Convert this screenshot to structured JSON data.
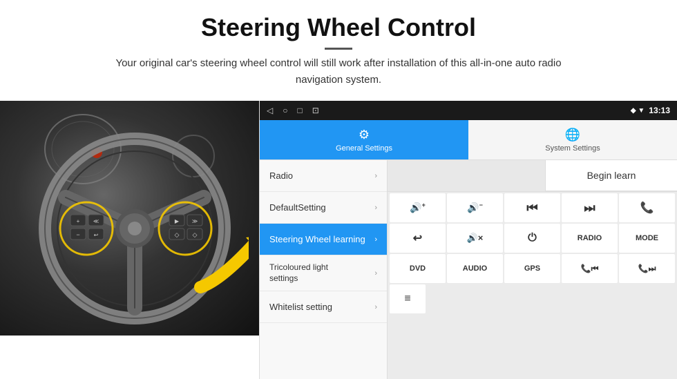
{
  "header": {
    "title": "Steering Wheel Control",
    "subtitle": "Your original car's steering wheel control will still work after installation of this all-in-one auto radio navigation system."
  },
  "status_bar": {
    "nav_back": "◁",
    "nav_home": "○",
    "nav_recent": "□",
    "nav_extra": "⊡",
    "wifi_icon": "wifi",
    "signal_icon": "signal",
    "time": "13:13"
  },
  "tabs": [
    {
      "id": "general",
      "label": "General Settings",
      "icon": "⚙",
      "active": true
    },
    {
      "id": "system",
      "label": "System Settings",
      "icon": "🌐",
      "active": false
    }
  ],
  "menu_items": [
    {
      "id": "radio",
      "label": "Radio",
      "active": false
    },
    {
      "id": "default",
      "label": "DefaultSetting",
      "active": false
    },
    {
      "id": "steering",
      "label": "Steering Wheel learning",
      "active": true
    },
    {
      "id": "tricolour",
      "label": "Tricoloured light settings",
      "active": false
    },
    {
      "id": "whitelist",
      "label": "Whitelist setting",
      "active": false
    }
  ],
  "controls": {
    "begin_learn_label": "Begin learn",
    "row1": [
      {
        "label": "🔊+",
        "id": "vol-up"
      },
      {
        "label": "🔊−",
        "id": "vol-down"
      },
      {
        "label": "⏮",
        "id": "prev"
      },
      {
        "label": "⏭",
        "id": "next"
      },
      {
        "label": "📞",
        "id": "call"
      }
    ],
    "row2": [
      {
        "label": "↩",
        "id": "back"
      },
      {
        "label": "🔊×",
        "id": "mute"
      },
      {
        "label": "⏻",
        "id": "power"
      },
      {
        "label": "RADIO",
        "id": "radio"
      },
      {
        "label": "MODE",
        "id": "mode"
      }
    ],
    "row3": [
      {
        "label": "DVD",
        "id": "dvd"
      },
      {
        "label": "AUDIO",
        "id": "audio"
      },
      {
        "label": "GPS",
        "id": "gps"
      },
      {
        "label": "📞⏮",
        "id": "tel-prev"
      },
      {
        "label": "📞⏭",
        "id": "tel-next"
      }
    ],
    "row4": [
      {
        "label": "📋",
        "id": "menu-icon"
      }
    ]
  }
}
